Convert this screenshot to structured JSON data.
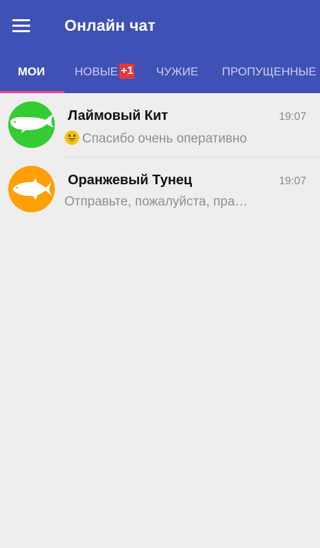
{
  "app": {
    "title": "Онлайн чат",
    "menu_icon": "hamburger-menu-icon",
    "colors": {
      "appbar": "#3f51b5",
      "tab_indicator": "#ff4081",
      "badge": "#e53935",
      "background": "#eeeeee"
    }
  },
  "tabs": [
    {
      "label": "МОИ",
      "active": true
    },
    {
      "label": "НОВЫЕ",
      "badge": "+1"
    },
    {
      "label": "ЧУЖИЕ"
    },
    {
      "label": "ПРОПУЩЕННЫЕ"
    }
  ],
  "chats": [
    {
      "name": "Лаймовый Кит",
      "time": "19:07",
      "preview": "Спасибо очень оперативно",
      "preview_icon": "smiley-emoji-icon",
      "avatar_icon": "whale-icon",
      "avatar_color": "#33cc33"
    },
    {
      "name": "Оранжевый Тунец",
      "time": "19:07",
      "preview": "Отправьте, пожалуйста, пра…",
      "avatar_icon": "tuna-fish-icon",
      "avatar_color": "#ffa000"
    }
  ]
}
